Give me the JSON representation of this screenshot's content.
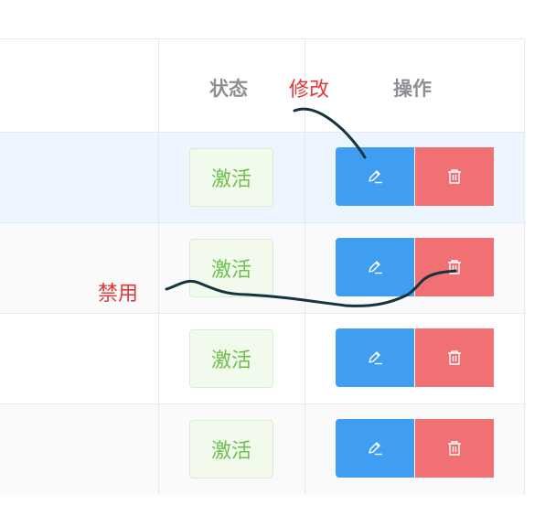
{
  "table": {
    "headers": {
      "status": "状态",
      "actions": "操作"
    },
    "rows": [
      {
        "status": "激活",
        "edit_icon": "pencil-icon",
        "delete_icon": "trash-icon"
      },
      {
        "status": "激活",
        "edit_icon": "pencil-icon",
        "delete_icon": "trash-icon"
      },
      {
        "status": "激活",
        "edit_icon": "pencil-icon",
        "delete_icon": "trash-icon"
      },
      {
        "status": "激活",
        "edit_icon": "pencil-icon",
        "delete_icon": "trash-icon"
      }
    ]
  },
  "annotations": {
    "edit_note": "修改",
    "disable_note": "禁用"
  },
  "colors": {
    "edit": "#3f9df2",
    "delete": "#f07073",
    "badge_text": "#6cc04a",
    "annotation": "#e0383a",
    "highlight_row": "#edf5ff"
  }
}
